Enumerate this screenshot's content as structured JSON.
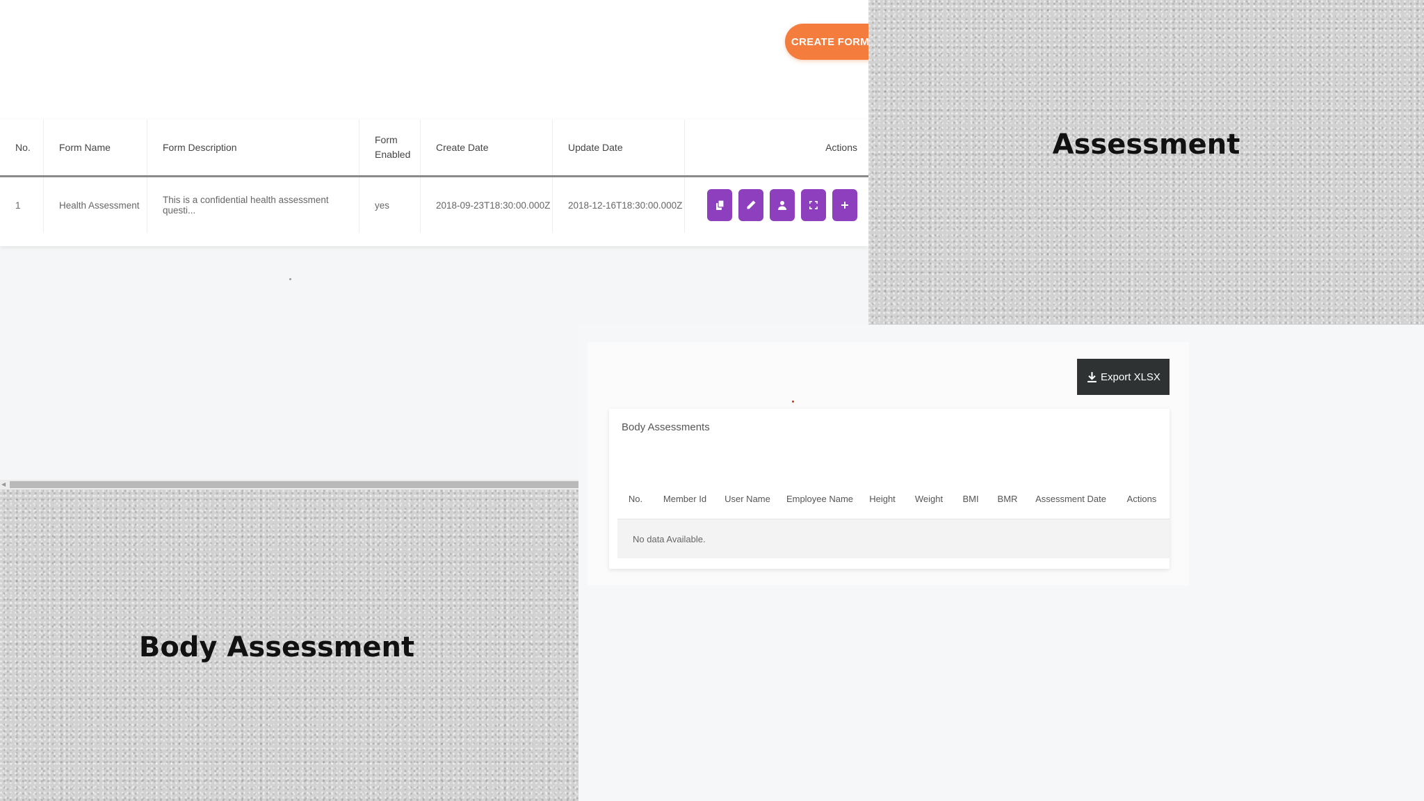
{
  "forms_page": {
    "create_form_label": "CREATE FORM",
    "table": {
      "headers": [
        "No.",
        "Form Name",
        "Form Description",
        "Form Enabled",
        "Create Date",
        "Update Date",
        "Actions"
      ],
      "rows": [
        [
          "1",
          "Health Assessment",
          "This is a confidential health assessment questi...",
          "yes",
          "2018-09-23T18:30:00.000Z",
          "2018-12-16T18:30:00.000Z"
        ]
      ]
    },
    "action_icons": [
      "copy-icon",
      "edit-icon",
      "users-icon",
      "fullscreen-icon",
      "plus-icon"
    ]
  },
  "captions": {
    "assessment": "Assessment",
    "body_assessment": "Body Assessment"
  },
  "body_page": {
    "export_label": "Export XLSX",
    "card_title": "Body Assessments",
    "table": {
      "headers": [
        "No.",
        "Member Id",
        "User Name",
        "Employee Name",
        "Height",
        "Weight",
        "BMI",
        "BMR",
        "Assessment Date",
        "Actions"
      ],
      "empty_text": "No data Available."
    }
  },
  "colors": {
    "accent_orange": "#f47c3c",
    "action_purple": "#8e3fbd",
    "export_dark": "#2f3233"
  }
}
